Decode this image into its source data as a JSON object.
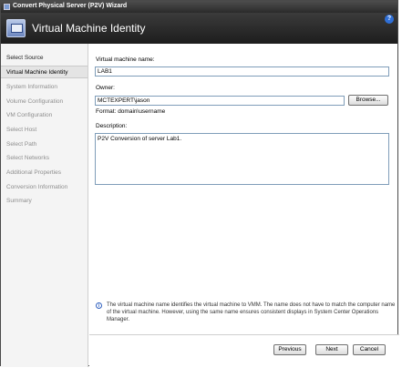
{
  "window": {
    "title": "Convert Physical Server (P2V) Wizard",
    "header_title": "Virtual Machine Identity",
    "help_glyph": "?"
  },
  "sidebar": {
    "items": [
      {
        "label": "Select Source",
        "state": "done"
      },
      {
        "label": "Virtual Machine Identity",
        "state": "active"
      },
      {
        "label": "System Information",
        "state": "pending"
      },
      {
        "label": "Volume Configuration",
        "state": "pending"
      },
      {
        "label": "VM Configuration",
        "state": "pending"
      },
      {
        "label": "Select Host",
        "state": "pending"
      },
      {
        "label": "Select Path",
        "state": "pending"
      },
      {
        "label": "Select Networks",
        "state": "pending"
      },
      {
        "label": "Additional Properties",
        "state": "pending"
      },
      {
        "label": "Conversion Information",
        "state": "pending"
      },
      {
        "label": "Summary",
        "state": "pending"
      }
    ]
  },
  "form": {
    "vm_name_label": "Virtual machine name:",
    "vm_name_value": "LAB1",
    "owner_label": "Owner:",
    "owner_value": "MCTEXPERT\\jason",
    "browse_label": "Browse...",
    "format_hint": "Format: domain\\username",
    "description_label": "Description:",
    "description_value": "P2V Conversion of server Lab1."
  },
  "info": {
    "icon": "info-icon",
    "text": "The virtual machine name identifies the virtual machine to VMM. The name does not have to match the computer name of the virtual machine. However, using the same name ensures consistent displays in System Center Operations Manager."
  },
  "footer": {
    "previous_label": "Previous",
    "next_label": "Next",
    "cancel_label": "Cancel"
  }
}
